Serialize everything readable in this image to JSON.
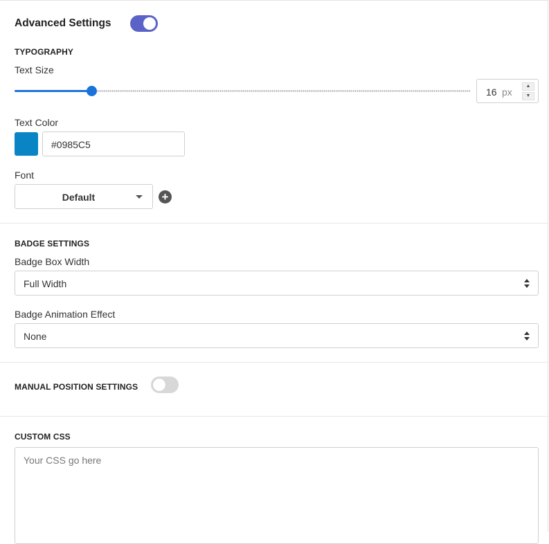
{
  "advanced": {
    "title": "Advanced Settings",
    "enabled": true,
    "accent_color": "#5b63c7"
  },
  "typography": {
    "section_title": "TYPOGRAPHY",
    "text_size_label": "Text Size",
    "text_size_value": "16",
    "text_size_unit": "px",
    "text_size_slider_fraction": 0.168,
    "slider_color": "#1a73d9",
    "text_color_label": "Text Color",
    "text_color_value": "#0985C5",
    "font_label": "Font",
    "font_value": "Default",
    "icons": {
      "add": "plus-circle-icon",
      "stepper_up": "caret-up-icon",
      "stepper_down": "caret-down-icon",
      "dropdown": "caret-down-icon"
    }
  },
  "badge": {
    "section_title": "BADGE SETTINGS",
    "box_width_label": "Badge Box Width",
    "box_width_value": "Full Width",
    "animation_label": "Badge Animation Effect",
    "animation_value": "None"
  },
  "manual_position": {
    "section_title": "MANUAL POSITION SETTINGS",
    "enabled": false
  },
  "custom_css": {
    "section_title": "CUSTOM CSS",
    "placeholder": "Your CSS go here"
  }
}
